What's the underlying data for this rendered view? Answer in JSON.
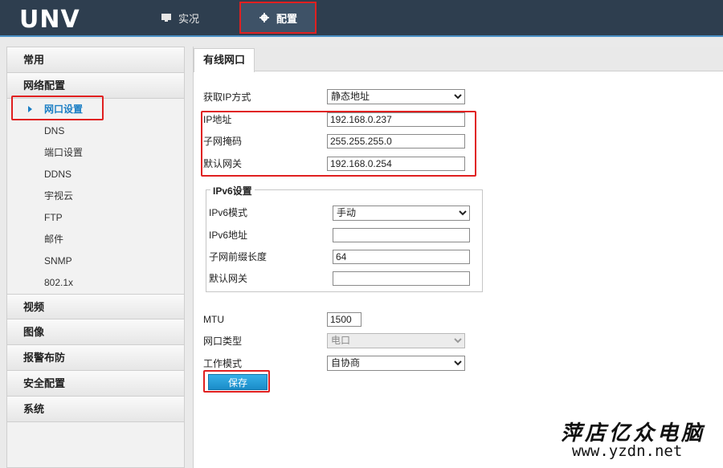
{
  "brand": {
    "logo_text": "UNV"
  },
  "topnav": {
    "live_label": "实况",
    "config_label": "配置"
  },
  "sidebar": {
    "sections": [
      {
        "label": "常用"
      },
      {
        "label": "网络配置"
      },
      {
        "label": "视频"
      },
      {
        "label": "图像"
      },
      {
        "label": "报警布防"
      },
      {
        "label": "安全配置"
      },
      {
        "label": "系统"
      }
    ],
    "network_items": [
      {
        "label": "网口设置",
        "active": true
      },
      {
        "label": "DNS"
      },
      {
        "label": "端口设置"
      },
      {
        "label": "DDNS"
      },
      {
        "label": "宇视云"
      },
      {
        "label": "FTP"
      },
      {
        "label": "邮件"
      },
      {
        "label": "SNMP"
      },
      {
        "label": "802.1x"
      }
    ]
  },
  "main": {
    "tab_label": "有线网口",
    "ip_mode_label": "获取IP方式",
    "ip_mode_value": "静态地址",
    "ip_label": "IP地址",
    "ip_value": "192.168.0.237",
    "mask_label": "子网掩码",
    "mask_value": "255.255.255.0",
    "gateway_label": "默认网关",
    "gateway_value": "192.168.0.254",
    "ipv6": {
      "legend": "IPv6设置",
      "mode_label": "IPv6模式",
      "mode_value": "手动",
      "addr_label": "IPv6地址",
      "addr_value": "",
      "prefix_label": "子网前缀长度",
      "prefix_value": "64",
      "gateway_label": "默认网关",
      "gateway_value": ""
    },
    "mtu_label": "MTU",
    "mtu_value": "1500",
    "port_type_label": "网口类型",
    "port_type_value": "电口",
    "work_mode_label": "工作模式",
    "work_mode_value": "自协商",
    "save_label": "保存"
  },
  "watermark": {
    "line1": "萍店亿众电脑",
    "line2": "www.yzdn.net"
  },
  "colors": {
    "topbar": "#2e3e4f",
    "accent": "#1a7ec4",
    "highlight": "#e02020"
  }
}
